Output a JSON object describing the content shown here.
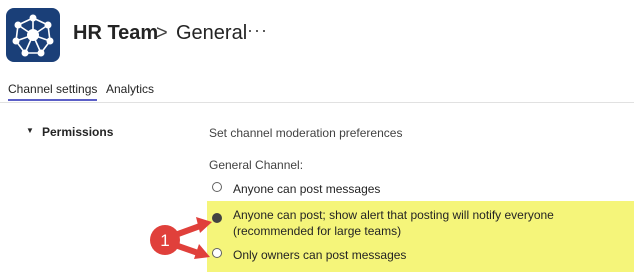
{
  "header": {
    "team_name": "HR Team",
    "separator": ">",
    "channel_name": "General",
    "more": "···"
  },
  "tabs": [
    {
      "label": "Channel settings",
      "active": true
    },
    {
      "label": "Analytics",
      "active": false
    }
  ],
  "permissions": {
    "title": "Permissions",
    "description": "Set channel moderation preferences",
    "subheading": "General Channel:",
    "options": [
      {
        "label": "Anyone can post messages",
        "selected": false
      },
      {
        "label": "Anyone can post; show alert that posting will notify everyone (recommended for large teams)",
        "selected": true
      },
      {
        "label": "Only owners can post messages",
        "selected": false
      }
    ]
  },
  "annotation": {
    "number": "1",
    "badge_color": "#e0403b",
    "arrow_color": "#e0403b",
    "highlight_color": "#f5f57a"
  }
}
